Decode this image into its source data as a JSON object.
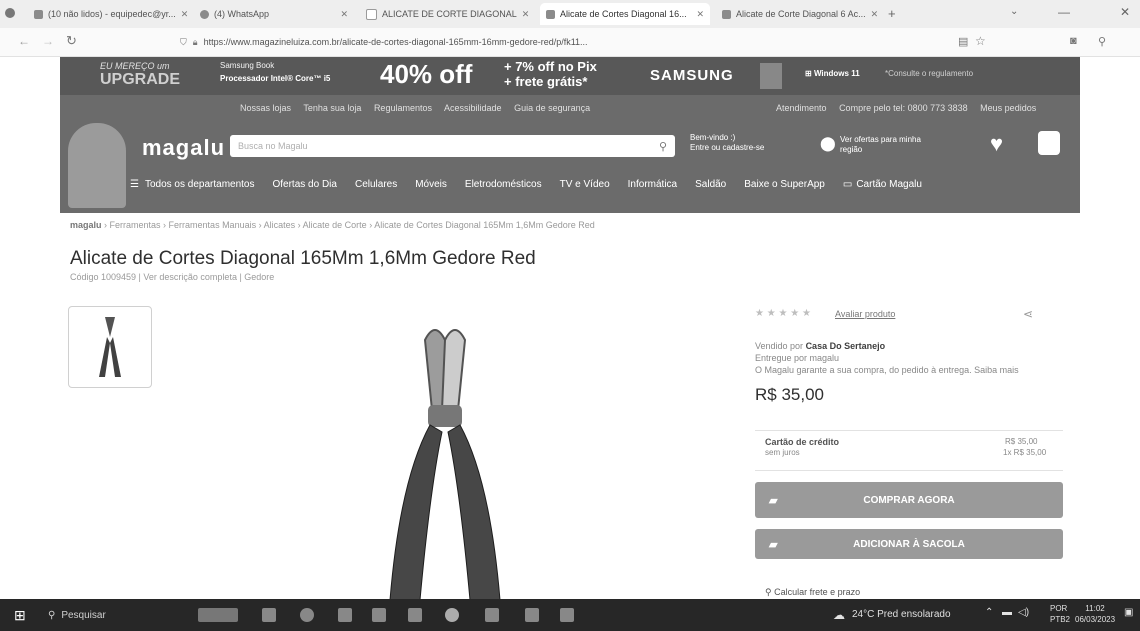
{
  "browser": {
    "tabs": [
      {
        "label": "(10 não lidos) - equipedec@yr..."
      },
      {
        "label": "(4) WhatsApp"
      },
      {
        "label": "ALICATE DE CORTE DIAGONAL"
      },
      {
        "label": "Alicate de Cortes Diagonal 16..."
      },
      {
        "label": "Alicate de Corte Diagonal 6 Ac..."
      }
    ],
    "new_tab": "+",
    "url": "https://www.magazineluiza.com.br/alicate-de-cortes-diagonal-165mm-16mm-gedore-red/p/fk11..."
  },
  "promo": {
    "upgrade_line1": "EU MEREÇO um",
    "upgrade_line2": "UPGRADE",
    "product_line1": "Samsung Book",
    "product_line2": "Processador Intel® Core™ i5",
    "discount": "40% off",
    "extra_line1": "+ 7% off no Pix",
    "extra_line2": "+ frete grátis*",
    "brand": "SAMSUNG",
    "windows": "Windows 11",
    "rules": "*Consulte o regulamento"
  },
  "header": {
    "top_links": [
      "Nossas lojas",
      "Tenha sua loja",
      "Regulamentos",
      "Acessibilidade",
      "Guia de segurança"
    ],
    "top_right": [
      "Atendimento",
      "Compre pelo tel: 0800 773 3838",
      "Meus pedidos"
    ],
    "logo": "magalu",
    "search_placeholder": "Busca no Magalu",
    "account_line1": "Bem-vindo :)",
    "account_line2": "Entre ou cadastre-se",
    "location_line1": "Ver ofertas para minha",
    "location_line2": "região",
    "departments": "Todos os departamentos",
    "nav": [
      "Ofertas do Dia",
      "Celulares",
      "Móveis",
      "Eletrodomésticos",
      "TV e Vídeo",
      "Informática",
      "Saldão",
      "Baixe o SuperApp",
      "Cartão Magalu"
    ]
  },
  "product": {
    "breadcrumb": [
      "magalu",
      "Ferramentas",
      "Ferramentas Manuais",
      "Alicates",
      "Alicate de Corte",
      "Alicate de Cortes Diagonal 165Mm 1,6Mm Gedore Red"
    ],
    "title": "Alicate de Cortes Diagonal 165Mm 1,6Mm Gedore Red",
    "subtitle": "Código 1009459 | Ver descrição completa | Gedore",
    "rating_link": "Avaliar produto",
    "sold_by_prefix": "Vendido por",
    "seller": "Casa Do Sertanejo",
    "delivered_by": "Entregue por magalu",
    "guarantee": "O Magalu garante a sua compra, do pedido à entrega. Saiba mais",
    "price": "R$ 35,00",
    "payment_label": "Cartão de crédito",
    "payment_sub": "sem juros",
    "payment_value1": "R$ 35,00",
    "payment_value2": "1x R$ 35,00",
    "buy_button": "COMPRAR AGORA",
    "bag_button": "ADICIONAR À SACOLA",
    "shipping": "Calcular frete e prazo"
  },
  "taskbar": {
    "search": "Pesquisar",
    "weather": "24°C  Pred ensolarado",
    "lang1": "POR",
    "lang2": "PTB2",
    "time": "11:02",
    "date": "06/03/2023"
  }
}
